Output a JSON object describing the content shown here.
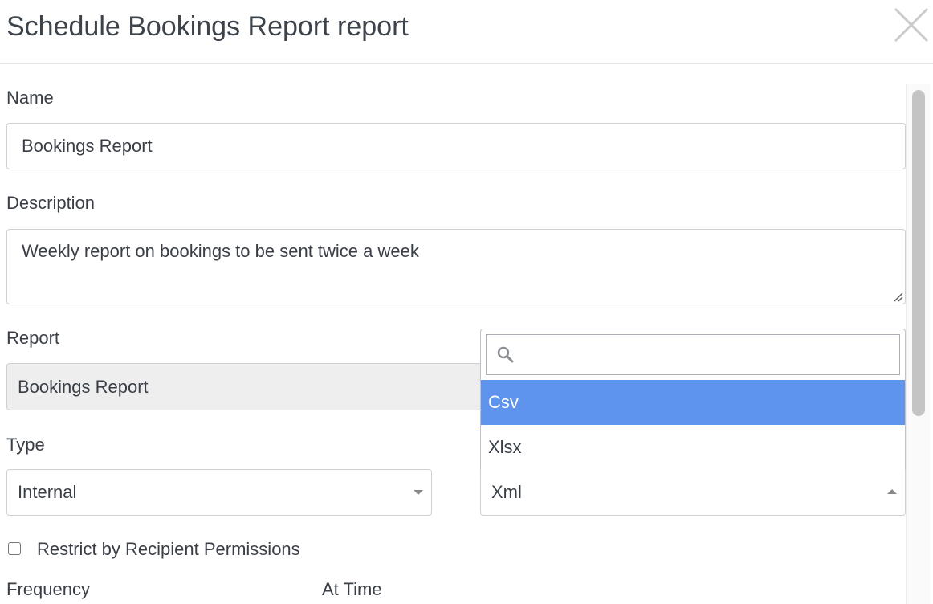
{
  "modal": {
    "title": "Schedule Bookings Report report",
    "close_icon": "close-icon"
  },
  "form": {
    "name": {
      "label": "Name",
      "value": "Bookings Report"
    },
    "description": {
      "label": "Description",
      "value": "Weekly report on bookings to be sent twice a week"
    },
    "report": {
      "label": "Report",
      "value": "Bookings Report"
    },
    "type": {
      "label": "Type",
      "value": "Internal"
    },
    "format": {
      "value": "Xml",
      "search_placeholder": "",
      "search_icon": "search-icon",
      "options": [
        "Csv",
        "Xlsx"
      ],
      "highlighted": "Csv"
    },
    "restrict": {
      "label": "Restrict by Recipient Permissions",
      "checked": false
    },
    "frequency": {
      "label": "Frequency"
    },
    "at_time": {
      "label": "At Time"
    }
  },
  "colors": {
    "highlight": "#5f94ee",
    "disabled_bg": "#eeeeee",
    "border": "#cdd1d6"
  }
}
